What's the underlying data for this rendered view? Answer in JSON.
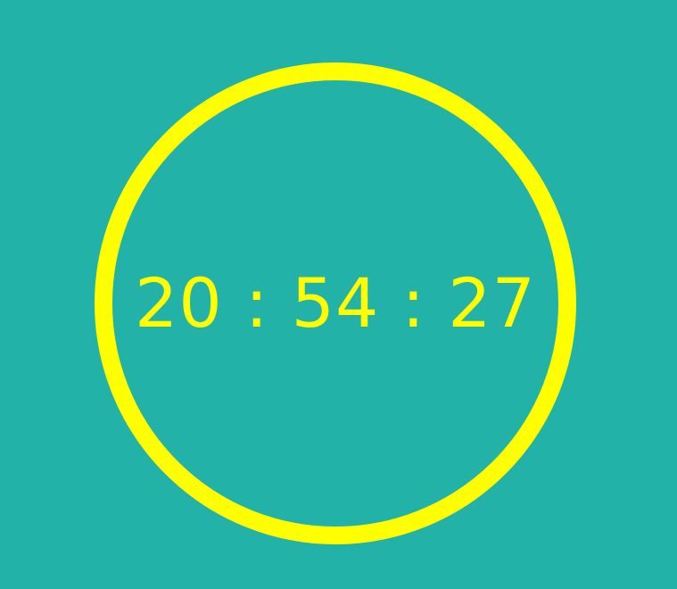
{
  "clock": {
    "time_text": "20 : 54 : 27"
  },
  "colors": {
    "background": "#22b2a8",
    "accent": "#ffff00"
  }
}
